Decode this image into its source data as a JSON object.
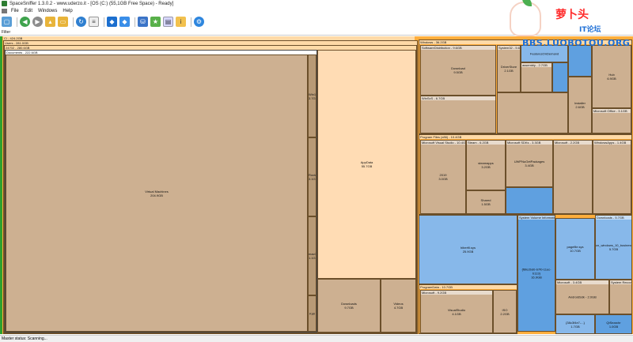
{
  "window": {
    "title": "SpaceSniffer 1.3.0.2 - www.uderzo.it - [OS (C:) (55,1GB Free Space) - Ready]"
  },
  "menu": {
    "items": [
      "File",
      "Edit",
      "Windows",
      "Help"
    ]
  },
  "toolbar": {
    "icons": [
      "new-scan-icon",
      "back-icon",
      "forward-icon",
      "folder-up-icon",
      "folder-icon",
      "refresh-icon",
      "document-icon",
      "cube-icon",
      "cube-alt-icon",
      "network-icon",
      "star-icon",
      "export-icon",
      "info-icon",
      "settings-icon"
    ]
  },
  "filter": {
    "label": "Filter"
  },
  "treemap": {
    "root_label": "C\\ - 424.2GB",
    "users_label": "Users - 281.0GB",
    "user_label": "24702 - 280.6GB",
    "documents_label": "Documents - 222.6GB",
    "virtual_machines": "Virtual Machines\n204.9GB",
    "vm_side_items": [
      "Win11\n3.7GB",
      "Rocky\n3.1GB",
      "macOS\n1.1GB",
      "Kali"
    ],
    "appdata": "AppData\n55.7GB",
    "downloads": "Downloads\n9.7GB",
    "videos": "Videos\n4.7GB",
    "windows_label": "Windows - 36.2GB",
    "softwaredistribution_label": "SoftwareDistribution - 9.6GB",
    "download_box": "Download\n9.5GB",
    "system32_label": "System32 - 5.6GB",
    "winsxs_label": "WinSxS - 6.7GB",
    "driverstore": "DriverStore\n2.1GB",
    "features": "FeaturesOnDemand",
    "assembly": "assembly - 2.7GB",
    "hub": "Hub\n6.9GB",
    "ms_office": "Microsoft Office - 3.1GB",
    "installer": "Installer\n2.6GB",
    "ms_windows_label": "WindowsApps - 1.4GB",
    "program_files_x86_label": "Program Files (x86) - 10.4GB",
    "visual_studio_label": "Microsoft Visual Studio - 10.4GB",
    "steam_label": "Steam - 6.2GB",
    "ms_sdks_label": "Microsoft SDKs - 3.3GB",
    "microsoft_label": "Microsoft - 2.2GB",
    "vs2019": "2019\n3.0GB",
    "steamapps": "steamapps\n3.2GB",
    "uwp_packages": "UWPNuGetPackages\n3.4GB",
    "shared": "Shared\n1.5GB",
    "pagefile_label": "System Volume Information",
    "hiberfil": "hiberfil.sys\n25.9GB",
    "pagefile": "pagefile.sys\n10.7GB",
    "swapfile": "{f6fe2bd0-b7f0-11ec-b113}\n16.9GB",
    "downloads_right": "Downloads - 5.7GB",
    "cn_windows": "cn_windows_10_business\n5.7GB",
    "system_recovery": "System Recovery",
    "programdata_label": "ProgramData - 10.7GB",
    "microsoft2_label": "Microsoft - 9.2GB",
    "visualstudio2": "VisualStudio\n4.1GB",
    "microsoft3_label": "Microsoft - 3.4GB",
    "android_sdk": "AndroidSdk - 2.0GB",
    "ms_programs": "Program Files\n1.2GB",
    "qtemp": "{38c3f4e7-...}\n1.7GB",
    "qtslayer": "QtSearchr\n1.0GB",
    "misc_small": "ISO\n2.2GB"
  },
  "status": {
    "text": "Master status: Scanning..."
  },
  "watermark": {
    "title": "萝卜头",
    "subtitle": "IT论坛",
    "url": "BBS.LUOBOTOU.ORG"
  },
  "colors": {
    "folder": "#ffae3d",
    "file_brown": "#cdb091",
    "file_peach": "#ffdcb4",
    "system_blue": "#5fa0e0",
    "accent_green": "#2ea02e"
  }
}
